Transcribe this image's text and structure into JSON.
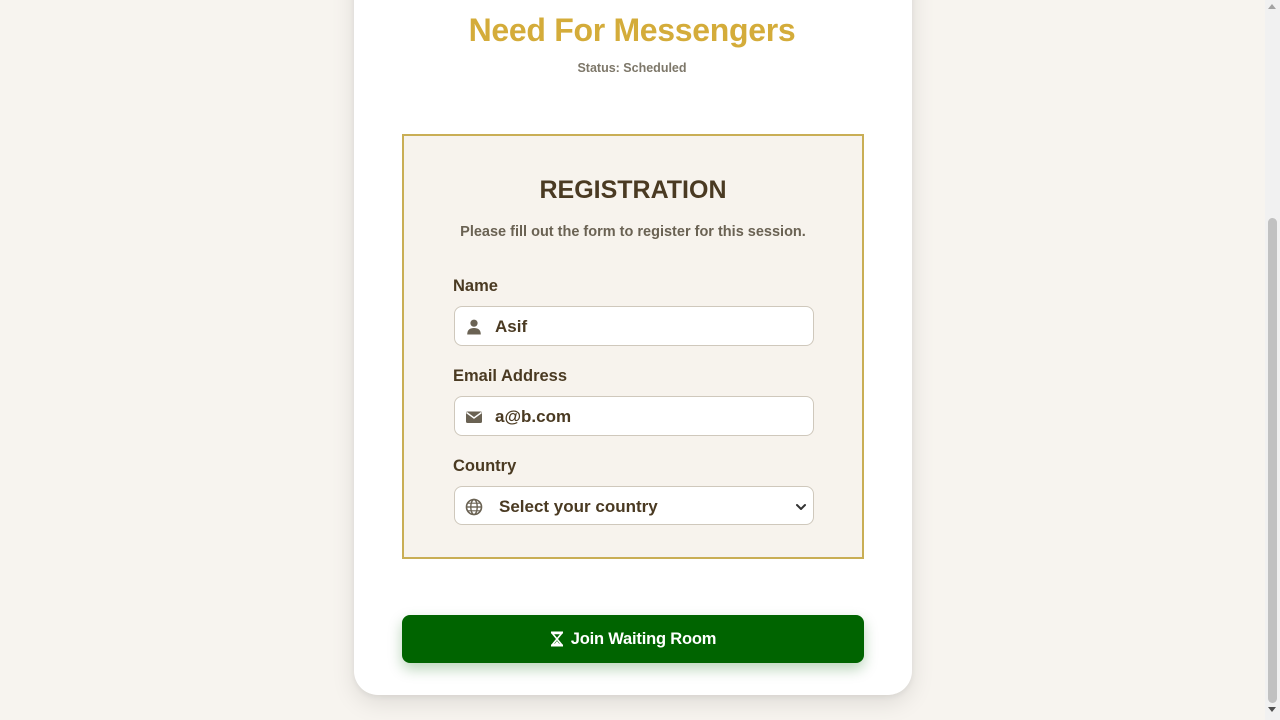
{
  "header": {
    "title": "Need For Messengers",
    "status": "Status: Scheduled"
  },
  "registration": {
    "title": "REGISTRATION",
    "subtitle": "Please fill out the form to register for this session.",
    "fields": {
      "name": {
        "label": "Name",
        "value": "Asif",
        "icon": "user-icon"
      },
      "email": {
        "label": "Email Address",
        "value": "a@b.com",
        "icon": "envelope-icon"
      },
      "country": {
        "label": "Country",
        "value": "Select your country",
        "icon": "globe-icon"
      }
    }
  },
  "actions": {
    "join_label": "Join Waiting Room",
    "join_icon": "hourglass-icon"
  },
  "colors": {
    "accent_gold": "#d4ac3a",
    "primary_green": "#006400",
    "text_brown": "#4a3a22",
    "background": "#f7f4ef"
  }
}
